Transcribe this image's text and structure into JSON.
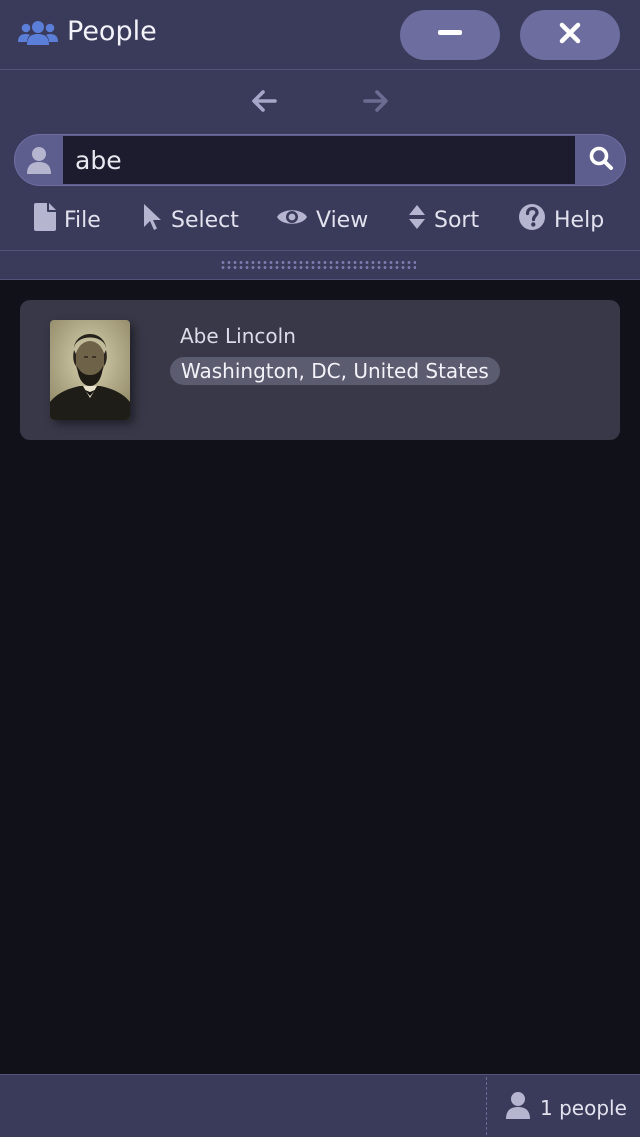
{
  "window": {
    "title": "People",
    "app_icon": "users-icon",
    "minimize_icon": "minus-icon",
    "close_icon": "close-icon"
  },
  "nav": {
    "back_icon": "arrow-left-icon",
    "forward_icon": "arrow-right-icon"
  },
  "search": {
    "value": "abe",
    "user_icon": "user-icon",
    "search_icon": "search-icon"
  },
  "toolbar": {
    "file": "File",
    "select": "Select",
    "view": "View",
    "sort": "Sort",
    "help": "Help"
  },
  "results": [
    {
      "name": "Abe Lincoln",
      "location": "Washington, DC, United States"
    }
  ],
  "status": {
    "count_text": "1 people"
  },
  "colors": {
    "chrome": "#3a3a5a",
    "accent": "#6d6da0",
    "background": "#111119",
    "card": "#383848",
    "app_icon": "#5b7fd8"
  }
}
